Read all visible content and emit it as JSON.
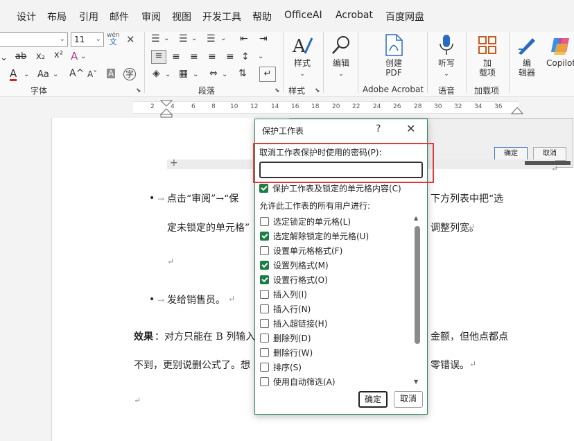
{
  "menu": {
    "tabs": [
      "设计",
      "布局",
      "引用",
      "邮件",
      "审阅",
      "视图",
      "开发工具",
      "帮助",
      "OfficeAI",
      "Acrobat",
      "百度网盘"
    ]
  },
  "ribbon": {
    "font_size": "11",
    "wen_glyph": "wén",
    "wen_char": "文",
    "font_group_label": "字体",
    "para_group_label": "段落",
    "style_group_label": "样式",
    "acrobat_group_label": "Adobe Acrobat",
    "voice_group_label": "语音",
    "addins_group_label": "加载项",
    "styles_button": "样式",
    "edit_button": "编辑",
    "create_pdf_line1": "创建",
    "create_pdf_line2": "PDF",
    "dictate_button": "听写",
    "addins_line1": "加",
    "addins_line2": "载项",
    "editor_line1": "编",
    "editor_line2": "辑器",
    "copilot_button": "Copilot",
    "strike_glyph": "ab",
    "sub_glyph": "x₂",
    "sup_glyph": "x²",
    "font_color_glyph": "A",
    "aa_glyph": "Aa",
    "grow_glyph": "A^",
    "shrink_glyph": "Aˇ",
    "char_shade_glyph": "A",
    "phonetic_glyph": "字"
  },
  "ruler": {
    "ticks": [
      "2",
      "4",
      "6",
      "8",
      "10",
      "12",
      "14",
      "16",
      "18",
      "20",
      "22",
      "24",
      "26",
      "28",
      "30",
      "32",
      "34",
      "36"
    ]
  },
  "bg_dialog": {
    "ok": "确定",
    "cancel": "取消"
  },
  "document": {
    "line1_a": "点击“审阅”→“保",
    "line1_b": "下方列表中把“选",
    "line2_a": "定未锁定的单元格”",
    "line2_b": "调整列宽。",
    "line4": "发给销售员。",
    "effect_label": "效果",
    "effect_a": "：对方只能在 B 列输入",
    "effect_b": "金额，但他点都点",
    "line6_a": "不到，更别说删公式了。想",
    "line6_b": "零错误。",
    "arrow_mark": "→",
    "return_mark": "↵"
  },
  "dialog": {
    "title": "保护工作表",
    "help": "?",
    "close": "✕",
    "password_label": "取消工作表保护时使用的密码(P):",
    "password_value": "",
    "protect_check_label": "保护工作表及锁定的单元格内容(C)",
    "protect_checked": true,
    "allow_label": "允许此工作表的所有用户进行:",
    "options": [
      {
        "label": "选定锁定的单元格(L)",
        "checked": false
      },
      {
        "label": "选定解除锁定的单元格(U)",
        "checked": true
      },
      {
        "label": "设置单元格格式(F)",
        "checked": false
      },
      {
        "label": "设置列格式(M)",
        "checked": true
      },
      {
        "label": "设置行格式(O)",
        "checked": true
      },
      {
        "label": "插入列(I)",
        "checked": false
      },
      {
        "label": "插入行(N)",
        "checked": false
      },
      {
        "label": "插入超链接(H)",
        "checked": false
      },
      {
        "label": "删除列(D)",
        "checked": false
      },
      {
        "label": "删除行(W)",
        "checked": false
      },
      {
        "label": "排序(S)",
        "checked": false
      },
      {
        "label": "使用自动筛选(A)",
        "checked": false
      }
    ],
    "ok": "确定",
    "cancel": "取消"
  },
  "colors": {
    "dialog_border": "#2e8b57",
    "checkbox_on": "#1e7d45",
    "highlight": "#e0393e"
  }
}
